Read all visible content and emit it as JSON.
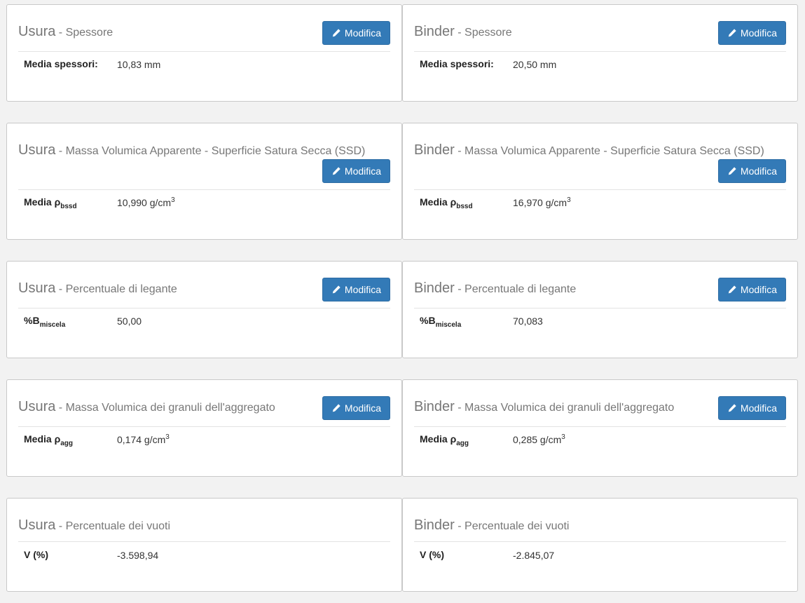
{
  "button_label": "Modifica",
  "button_icon": "pencil-icon",
  "accent_color": "#337ab7",
  "sections": [
    {
      "subtitle": "Spessore",
      "label": "Media spessori:",
      "label_sub": "",
      "cards": [
        {
          "layer": "Usura",
          "value": "10,83 mm",
          "unit_sup": ""
        },
        {
          "layer": "Binder",
          "value": "20,50 mm",
          "unit_sup": ""
        }
      ]
    },
    {
      "subtitle": "Massa Volumica Apparente - Superficie Satura Secca (SSD)",
      "label": "Media ρ",
      "label_sub": "bssd",
      "cards": [
        {
          "layer": "Usura",
          "value": "10,990 g/cm",
          "unit_sup": "3"
        },
        {
          "layer": "Binder",
          "value": "16,970 g/cm",
          "unit_sup": "3"
        }
      ]
    },
    {
      "subtitle": "Percentuale di legante",
      "label": "%B",
      "label_sub": "miscela",
      "cards": [
        {
          "layer": "Usura",
          "value": "50,00",
          "unit_sup": ""
        },
        {
          "layer": "Binder",
          "value": "70,083",
          "unit_sup": ""
        }
      ]
    },
    {
      "subtitle": "Massa Volumica dei granuli dell'aggregato",
      "label": "Media ρ",
      "label_sub": "agg",
      "cards": [
        {
          "layer": "Usura",
          "value": "0,174 g/cm",
          "unit_sup": "3"
        },
        {
          "layer": "Binder",
          "value": "0,285 g/cm",
          "unit_sup": "3"
        }
      ]
    },
    {
      "subtitle": "Percentuale dei vuoti",
      "label": "V (%)",
      "label_sub": "",
      "cards": [
        {
          "layer": "Usura",
          "value": "-3.598,94",
          "unit_sup": ""
        },
        {
          "layer": "Binder",
          "value": "-2.845,07",
          "unit_sup": ""
        }
      ]
    }
  ]
}
